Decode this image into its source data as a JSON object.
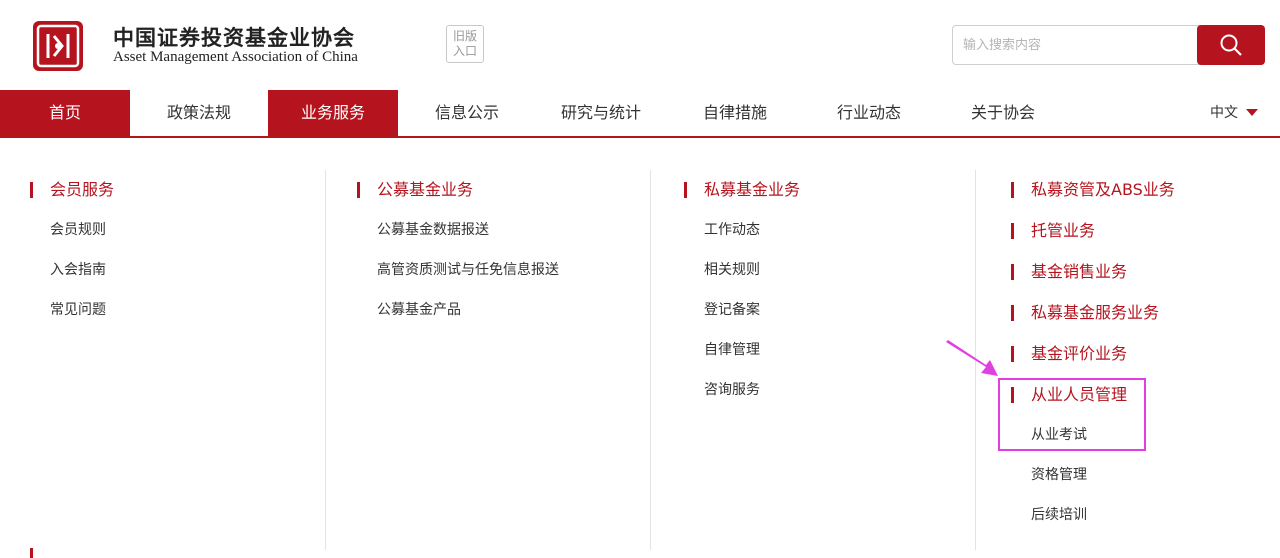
{
  "header": {
    "logo_cn": "中国证券投资基金业协会",
    "logo_en": "Asset Management Association of China",
    "old_entry": [
      "旧版",
      "入口"
    ],
    "search": {
      "placeholder": "输入搜索内容",
      "button_icon": "search-icon"
    },
    "brand_color": "#b5141f"
  },
  "nav": {
    "items": [
      {
        "label": "首页",
        "state": "active"
      },
      {
        "label": "政策法规"
      },
      {
        "label": "业务服务",
        "state": "active"
      },
      {
        "label": "信息公示"
      },
      {
        "label": "研究与统计"
      },
      {
        "label": "自律措施"
      },
      {
        "label": "行业动态"
      },
      {
        "label": "关于协会"
      }
    ],
    "language": "中文"
  },
  "dropdown": {
    "col1": {
      "title": "会员服务",
      "items": [
        "会员规则",
        "入会指南",
        "常见问题"
      ]
    },
    "col2": {
      "title": "公募基金业务",
      "items": [
        "公募基金数据报送",
        "高管资质测试与任免信息报送",
        "公募基金产品"
      ]
    },
    "col3": {
      "title": "私募基金业务",
      "items": [
        "工作动态",
        "相关规则",
        "登记备案",
        "自律管理",
        "咨询服务"
      ]
    },
    "col4": {
      "titles": [
        "私募资管及ABS业务",
        "托管业务",
        "基金销售业务",
        "私募基金服务业务",
        "基金评价业务"
      ],
      "personnel": {
        "title": "从业人员管理",
        "items": [
          "从业考试",
          "资格管理",
          "后续培训"
        ]
      }
    }
  },
  "annotation": {
    "highlight_color": "#e040e0"
  }
}
